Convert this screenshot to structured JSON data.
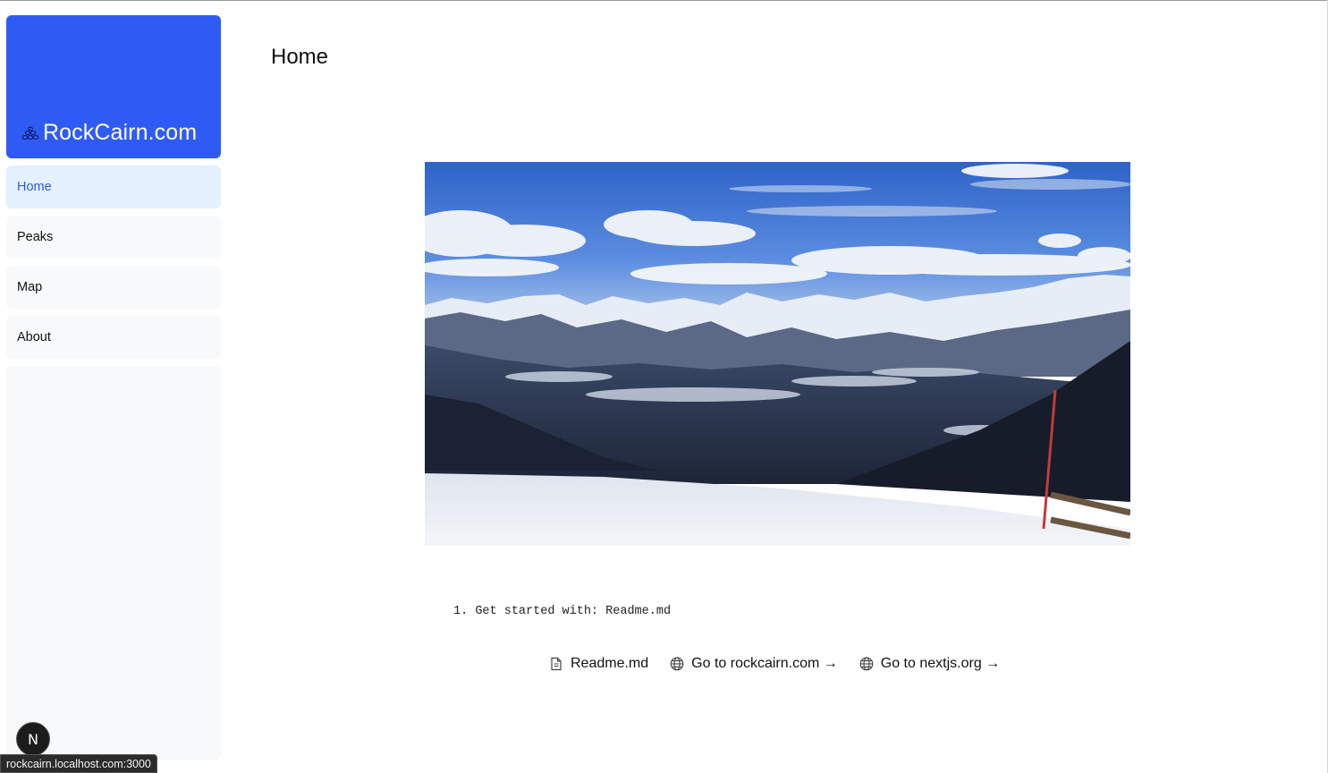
{
  "sidebar": {
    "brand_title": "RockCairn.com",
    "brand_icon": "cairn-icon",
    "accent_color": "#2f5bf5",
    "items": [
      {
        "label": "Home",
        "active": true
      },
      {
        "label": "Peaks",
        "active": false
      },
      {
        "label": "Map",
        "active": false
      },
      {
        "label": "About",
        "active": false
      }
    ]
  },
  "main": {
    "title": "Home",
    "hero_image": "snowy-mountain-valley-photo",
    "steps": [
      "Get started with: Readme.md"
    ],
    "links": [
      {
        "icon": "file-icon",
        "label": "Readme.md"
      },
      {
        "icon": "globe-icon",
        "label": "Go to rockcairn.com →"
      },
      {
        "icon": "globe-icon",
        "label": "Go to nextjs.org →"
      }
    ]
  },
  "devtools": {
    "badge": "N"
  },
  "status_bar": {
    "url": "rockcairn.localhost.com:3000"
  }
}
